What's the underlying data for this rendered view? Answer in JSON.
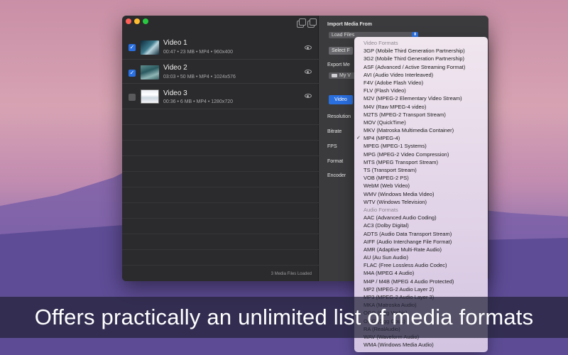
{
  "window": {
    "files": [
      {
        "title": "Video 1",
        "meta": "00:47 • 23 MB • MP4 • 960x400",
        "checked": true
      },
      {
        "title": "Video 2",
        "meta": "03:03 • 50 MB • MP4 • 1024x576",
        "checked": true
      },
      {
        "title": "Video 3",
        "meta": "00:36 • 6 MB • MP4 • 1280x720",
        "checked": false
      }
    ],
    "footer": "3 Media Files Loaded"
  },
  "settings": {
    "import_label": "Import Media From",
    "import_value": "Load Files",
    "select_button": "Select F",
    "export_label": "Export Me",
    "export_value": "My V",
    "mode_tab": "Video",
    "resolution_label": "Resolution",
    "bitrate_label": "Bitrate",
    "fps_label": "FPS",
    "format_label": "Format",
    "encoder_label": "Encoder"
  },
  "dropdown": {
    "video_header": "Video Formats",
    "video_items": [
      "3GP (Mobile Third Generation Partnership)",
      "3G2 (Mobile Third Generation Partnership)",
      "ASF (Advanced / Active Streaming Format)",
      "AVI (Audio Video Interleaved)",
      "F4V (Adobe Flash Video)",
      "FLV (Flash Video)",
      "M2V (MPEG-2 Elementary Video Stream)",
      "M4V (Raw MPEG-4 video)",
      "M2TS (MPEG-2 Transport Stream)",
      "MOV (QuickTime)",
      "MKV (Matroska Multimedia Container)",
      "MP4 (MPEG-4)",
      "MPEG (MPEG-1 Systems)",
      "MPG (MPEG-2 Video Compression)",
      "MTS (MPEG Transport Stream)",
      "TS (Transport Stream)",
      "VOB (MPEG-2 PS)",
      "WebM (Web Video)",
      "WMV (Windows Media Video)",
      "WTV (Windows Television)"
    ],
    "selected_index": 11,
    "check_glyph": "✓",
    "audio_header": "Audio Formats",
    "audio_items": [
      "AAC (Advanced Audio Coding)",
      "AC3 (Dolby Digital)",
      "ADTS (Audio Data Transport Stream)",
      "AIFF (Audio Interchange File Format)",
      "AMR (Adaptive Multi-Rate Audio)",
      "AU (Au Sun Audio)",
      "FLAC (Free Lossless Audio Codec)",
      "M4A (MPEG 4 Audio)",
      "M4P / M4B (MPEG 4 Audio Protected)",
      "MP2 (MPEG-2 Audio Layer 2)",
      "MP3 (MPEG-2 Audio Layer 3)",
      "MKA (Matroska Audio)",
      "OGG (Ogg Vorbis)",
      "OGG (Ogg Opus)",
      "RA (RealAudio)",
      "WAV (Waveform Audio)",
      "WMA (Windows Media Audio)"
    ]
  },
  "banner": {
    "text": "Offers practically an unlimited list of media formats"
  }
}
